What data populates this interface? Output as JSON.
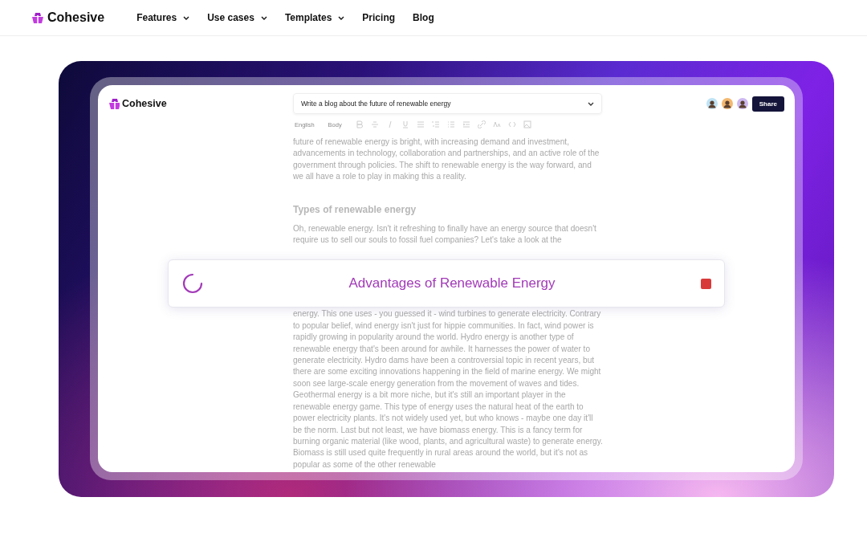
{
  "site_nav": {
    "brand": "Cohesive",
    "items": [
      {
        "label": "Features",
        "has_dropdown": true
      },
      {
        "label": "Use cases",
        "has_dropdown": true
      },
      {
        "label": "Templates",
        "has_dropdown": true
      },
      {
        "label": "Pricing",
        "has_dropdown": false
      },
      {
        "label": "Blog",
        "has_dropdown": false
      }
    ]
  },
  "app": {
    "brand": "Cohesive",
    "prompt": "Write a blog about the future of renewable energy",
    "share_button": "Share",
    "toolbar": {
      "language": "English",
      "style": "Body"
    },
    "document": [
      {
        "kind": "paragraph",
        "text": "future of renewable energy is bright, with increasing demand and investment, advancements in technology, collaboration and partnerships, and an active role of the government through policies. The shift to renewable energy is the way forward, and we all have a role to play in making this a reality."
      },
      {
        "kind": "heading",
        "text": "Types of renewable energy"
      },
      {
        "kind": "paragraph",
        "text": "Oh, renewable energy. Isn't it refreshing to finally have an energy source that doesn't require us to sell our souls to fossil fuel companies? Let's take a look at the"
      },
      {
        "kind": "paragraph",
        "text": "energy. This one uses - you guessed it - wind turbines to generate electricity. Contrary to popular belief, wind energy isn't just for hippie communities. In fact, wind power is rapidly growing in popularity around the world. Hydro energy is another type of renewable energy that's been around for awhile. It harnesses the power of water to generate electricity. Hydro dams have been a controversial topic in recent years, but there are some exciting innovations happening in the field of marine energy. We might soon see large-scale energy generation from the movement of waves and tides. Geothermal energy is a bit more niche, but it's still an important player in the renewable energy game. This type of energy uses the natural heat of the earth to power electricity plants. It's not widely used yet, but who knows - maybe one day it'll be the norm. Last but not least, we have biomass energy. This is a fancy term for burning organic material (like wood, plants, and agricultural waste) to generate energy. Biomass is still used quite frequently in rural areas around the world, but it's not as popular as some of the other renewable"
      }
    ],
    "generating": {
      "title": "Advantages of Renewable Energy",
      "in_progress": true
    }
  }
}
